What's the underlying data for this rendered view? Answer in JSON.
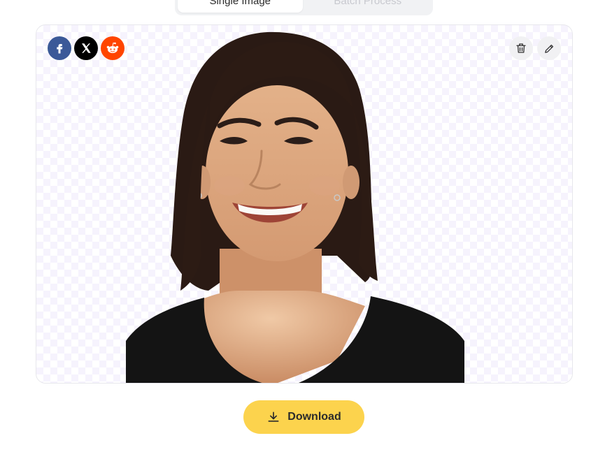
{
  "tabs": [
    {
      "label": "Single Image",
      "active": true
    },
    {
      "label": "Batch Process",
      "active": false
    }
  ],
  "preview": {
    "image_alt": "Smiling woman with shoulder-length dark hair, background removed",
    "background": "transparency checkerboard"
  },
  "share": [
    {
      "network": "Facebook",
      "icon": "facebook-icon",
      "color": "#3b5998"
    },
    {
      "network": "X",
      "icon": "x-icon",
      "color": "#000000"
    },
    {
      "network": "Reddit",
      "icon": "reddit-icon",
      "color": "#ff4500"
    }
  ],
  "tools": [
    {
      "action": "Delete",
      "icon": "trash-icon"
    },
    {
      "action": "Edit",
      "icon": "pencil-icon"
    }
  ],
  "download": {
    "label": "Download",
    "icon": "download-icon",
    "color": "#fcd34d"
  }
}
